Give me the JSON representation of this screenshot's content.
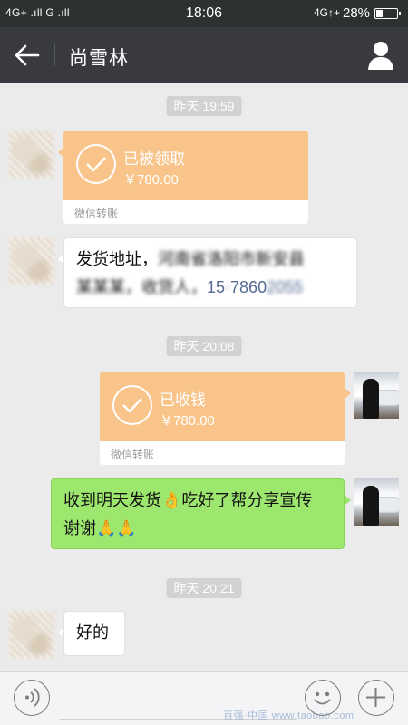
{
  "status_bar": {
    "network_left": "4G+ .ıll  G .ıll",
    "time": "18:06",
    "network_right": "4G↑+",
    "battery_percent": "28%",
    "battery_level": 0.28
  },
  "header": {
    "title": "尚雪林",
    "back_icon": "back-arrow-icon",
    "profile_icon": "person-icon"
  },
  "messages": {
    "ts1": "昨天 19:59",
    "transfer1": {
      "status": "已被领取",
      "amount": "￥780.00",
      "caption": "微信转账"
    },
    "addr_line1_a": "发货地址，",
    "addr_line1_b": "河南省洛阳市新安县",
    "addr_line2_a": "某某某，收货人，",
    "addr_line2_b": "15",
    "addr_line2_c": "7860",
    "addr_line2_d": "2055",
    "ts2": "昨天 20:08",
    "transfer2": {
      "status": "已收钱",
      "amount": "￥780.00",
      "caption": "微信转账"
    },
    "reply_line1_a": "收到明天发货",
    "reply_emoji1": "👌",
    "reply_line1_b": "吃好了帮分享宣传",
    "reply_line2": "谢谢",
    "reply_emoji2": "🙏🙏",
    "ts3": "昨天 20:21",
    "ok": "好的"
  },
  "input_bar": {
    "voice_icon": "voice-icon",
    "emoji_icon": "emoji-icon",
    "plus_icon": "plus-icon",
    "watermark": "百强·中国  www.taobao.com"
  },
  "colors": {
    "statusbar": "#2e3132",
    "titlebar": "#393a3f",
    "chat_bg": "#ebebeb",
    "transfer_orange": "#f9c48a",
    "bubble_green": "#9de76f",
    "link_blue": "#576b95"
  }
}
